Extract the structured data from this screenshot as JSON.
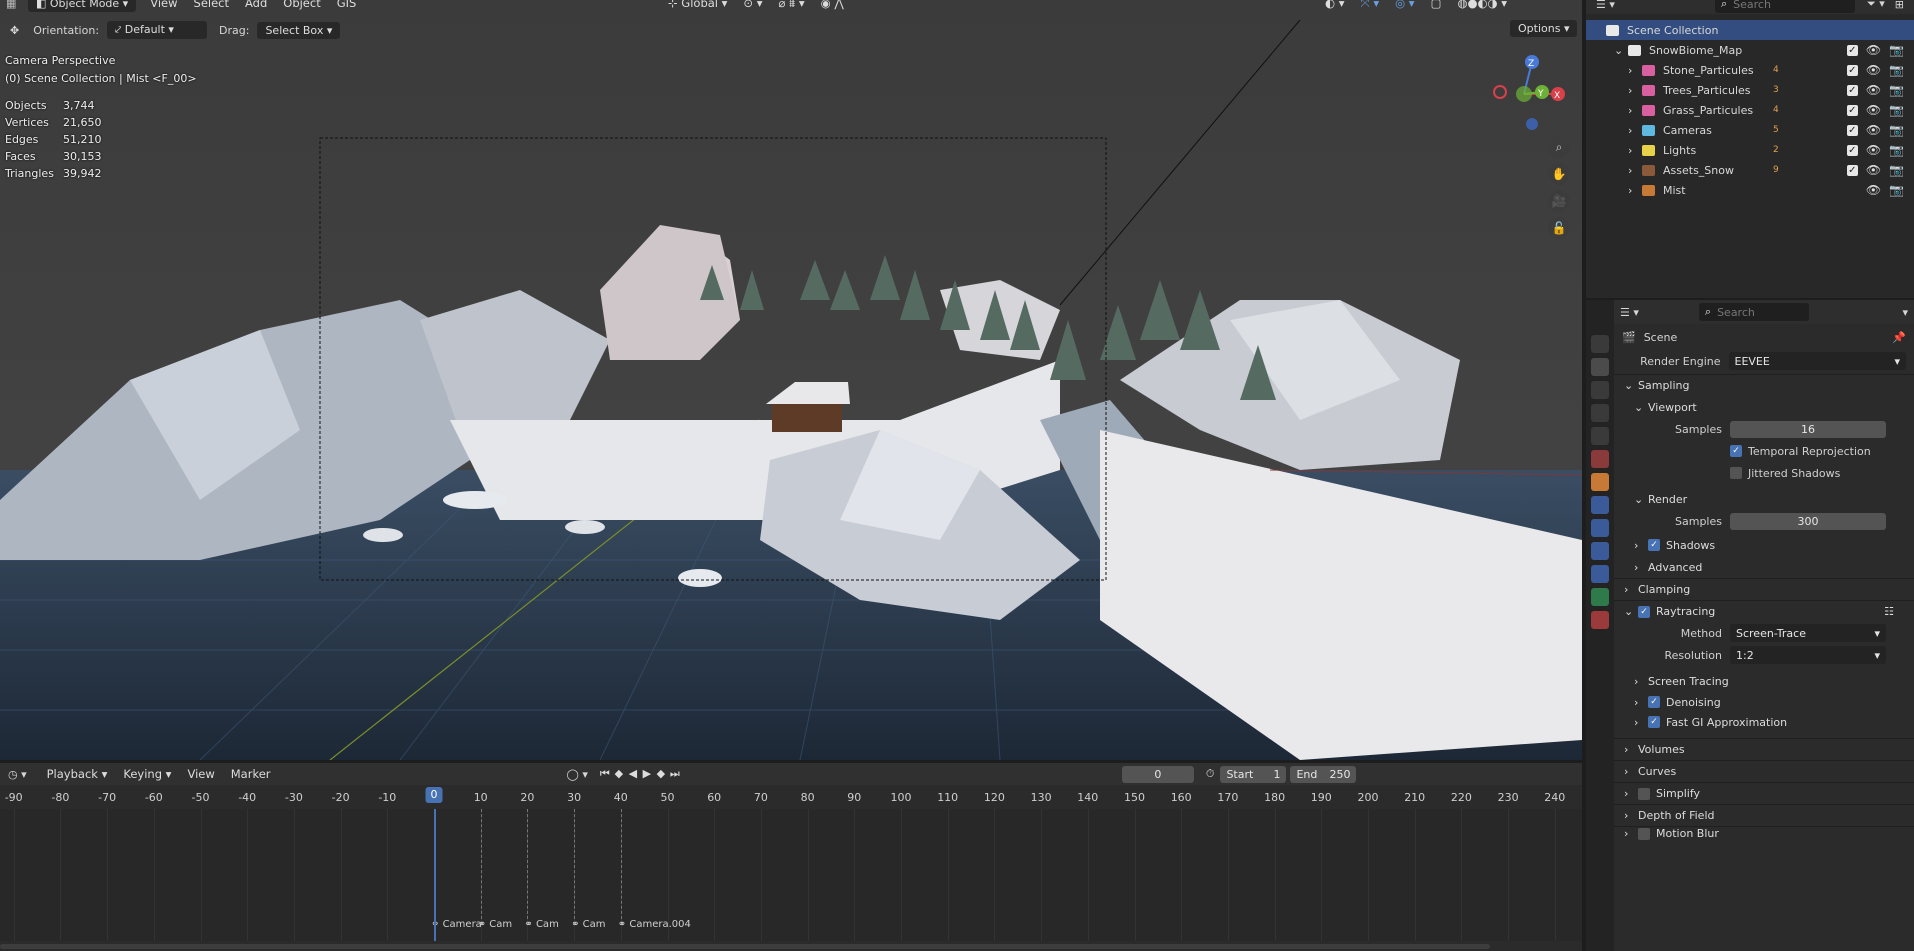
{
  "header": {
    "mode": "Object Mode",
    "menus": [
      "View",
      "Select",
      "Add",
      "Object",
      "GIS"
    ],
    "transform": "Global",
    "orientation_label": "Orientation:",
    "orientation_value": "Default",
    "drag_label": "Drag:",
    "drag_value": "Select Box",
    "options": "Options"
  },
  "viewport": {
    "line1": "Camera Perspective",
    "line2": "(0) Scene Collection | Mist <F_00>",
    "stats": [
      {
        "k": "Objects",
        "v": "3,744"
      },
      {
        "k": "Vertices",
        "v": "21,650"
      },
      {
        "k": "Edges",
        "v": "51,210"
      },
      {
        "k": "Faces",
        "v": "30,153"
      },
      {
        "k": "Triangles",
        "v": "39,942"
      }
    ],
    "gizmo_z": "Z",
    "gizmo_y": "Y",
    "gizmo_x": "X"
  },
  "outliner": {
    "search_placeholder": "Search",
    "root": "Scene Collection",
    "map": "SnowBiome_Map",
    "items": [
      {
        "name": "Stone_Particules",
        "badge": "4",
        "color": "#d85fa0"
      },
      {
        "name": "Trees_Particules",
        "badge": "3",
        "color": "#d85fa0"
      },
      {
        "name": "Grass_Particules",
        "badge": "4",
        "color": "#d85fa0"
      },
      {
        "name": "Cameras",
        "badge": "5",
        "color": "#5fb8e0"
      },
      {
        "name": "Lights",
        "badge": "2",
        "color": "#e8d24a"
      },
      {
        "name": "Assets_Snow",
        "badge": "9",
        "color": "#8b5a3a"
      },
      {
        "name": "Mist",
        "badge": "",
        "color": "#c77a35"
      }
    ]
  },
  "properties": {
    "search_placeholder": "Search",
    "scene": "Scene",
    "render_engine_label": "Render Engine",
    "render_engine": "EEVEE",
    "sampling": "Sampling",
    "viewport": "Viewport",
    "samples_label": "Samples",
    "viewport_samples": "16",
    "temporal": "Temporal Reprojection",
    "jittered": "Jittered Shadows",
    "render": "Render",
    "render_samples": "300",
    "shadows": "Shadows",
    "advanced": "Advanced",
    "clamping": "Clamping",
    "raytracing": "Raytracing",
    "method_label": "Method",
    "method": "Screen-Trace",
    "resolution_label": "Resolution",
    "resolution": "1:2",
    "screen_tracing": "Screen Tracing",
    "denoising": "Denoising",
    "fast_gi": "Fast GI Approximation",
    "volumes": "Volumes",
    "curves": "Curves",
    "simplify": "Simplify",
    "dof": "Depth of Field",
    "motion_blur": "Motion Blur"
  },
  "timeline": {
    "menus": [
      "Playback",
      "Keying",
      "View",
      "Marker"
    ],
    "current_frame": "0",
    "start_label": "Start",
    "start": "1",
    "end_label": "End",
    "end": "250",
    "ticks": [
      "-90",
      "-80",
      "-70",
      "-60",
      "-50",
      "-40",
      "-30",
      "-20",
      "-10",
      "0",
      "10",
      "20",
      "30",
      "40",
      "50",
      "60",
      "70",
      "80",
      "90",
      "100",
      "110",
      "120",
      "130",
      "140",
      "150",
      "160",
      "170",
      "180",
      "190",
      "200",
      "210",
      "220",
      "230",
      "240"
    ],
    "markers": [
      "Camera",
      "Cam",
      "Cam",
      "Cam",
      "Camera.004"
    ]
  },
  "colors": {
    "accent": "#4772b3",
    "header": "#303030",
    "panel": "#2b2b2b"
  }
}
